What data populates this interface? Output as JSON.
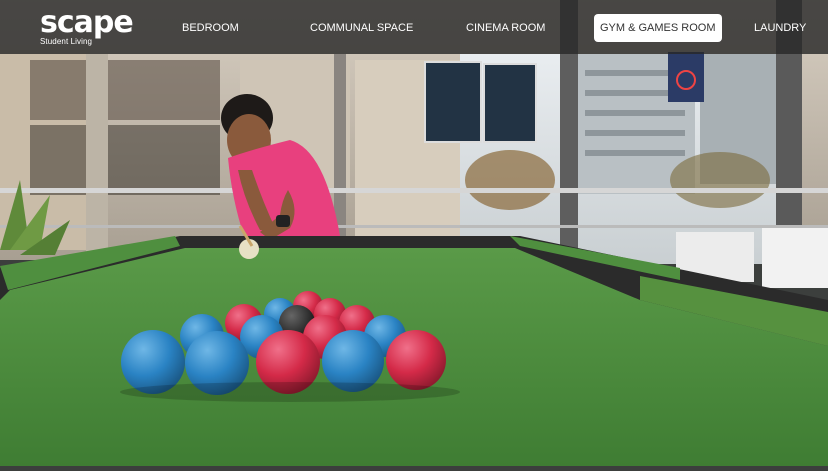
{
  "brand": {
    "name": "scape",
    "tagline": "Student Living"
  },
  "nav": {
    "items": [
      {
        "label": "Bedroom"
      },
      {
        "label": "Communal Space"
      },
      {
        "label": "Cinema Room"
      },
      {
        "label": "Gym & Games Room",
        "active": true
      },
      {
        "label": "Laundry"
      }
    ]
  },
  "scene": {
    "description_icon": "pool-table-photo",
    "colors": {
      "felt": "#4b8a3c",
      "ball_red": "#d42a48",
      "ball_blue": "#2a83c4",
      "shirt": "#e8407e"
    }
  }
}
